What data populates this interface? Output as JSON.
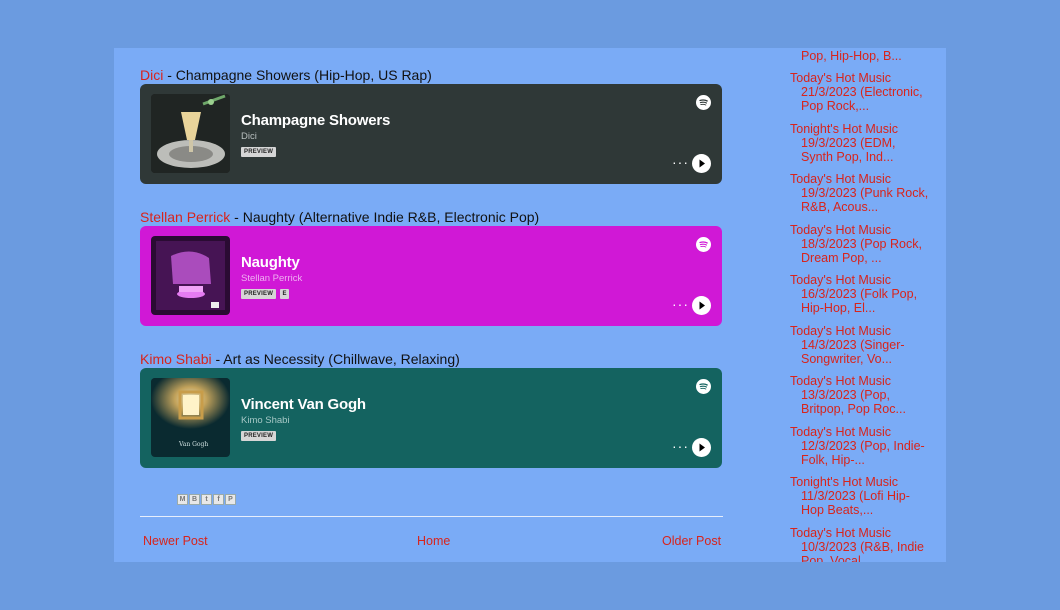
{
  "posts": [
    {
      "artist": "Dici",
      "title_rest": " - Champagne Showers (Hip-Hop, US Rap)",
      "card": {
        "track": "Champagne Showers",
        "artist": "Dici",
        "badges": [
          "PREVIEW"
        ],
        "bg_color": "#2f3837",
        "artist_color": "#b9c0bf"
      }
    },
    {
      "artist": "Stellan Perrick",
      "title_rest": " - Naughty (Alternative Indie R&B, Electronic Pop)",
      "card": {
        "track": "Naughty",
        "artist": "Stellan Perrick",
        "badges": [
          "PREVIEW",
          "E"
        ],
        "bg_color": "#d018d6",
        "artist_color": "#f0b0f2"
      }
    },
    {
      "artist": "Kimo Shabi",
      "title_rest": " - Art as Necessity (Chillwave, Relaxing)",
      "card": {
        "track": "Vincent Van Gogh",
        "artist": "Kimo Shabi",
        "badges": [
          "PREVIEW"
        ],
        "bg_color": "#146360",
        "artist_color": "#a6c8c6"
      }
    }
  ],
  "share_icons": [
    "email-icon",
    "blogger-icon",
    "twitter-icon",
    "facebook-icon",
    "pinterest-icon"
  ],
  "pager": {
    "newer": "Newer Post",
    "home": "Home",
    "older": "Older Post"
  },
  "sidebar": {
    "partial_top": "Pop, Hip-Hop, B...",
    "links": [
      {
        "line1": "Today's Hot Music",
        "rest": "21/3/2023 (Electronic, Pop Rock,..."
      },
      {
        "line1": "Tonight's Hot Music",
        "rest": "19/3/2023 (EDM, Synth Pop, Ind..."
      },
      {
        "line1": "Today's Hot Music",
        "rest": "19/3/2023 (Punk Rock, R&B, Acous..."
      },
      {
        "line1": "Today's Hot Music",
        "rest": "18/3/2023 (Pop Rock, Dream Pop, ..."
      },
      {
        "line1": "Today's Hot Music",
        "rest": "16/3/2023 (Folk Pop, Hip-Hop, El..."
      },
      {
        "line1": "Today's Hot Music",
        "rest": "14/3/2023 (Singer-Songwriter, Vo..."
      },
      {
        "line1": "Today's Hot Music",
        "rest": "13/3/2023 (Pop, Britpop, Pop Roc..."
      },
      {
        "line1": "Today's Hot Music",
        "rest": "12/3/2023 (Pop, Indie-Folk, Hip-..."
      },
      {
        "line1": "Tonight's Hot Music",
        "rest": "11/3/2023 (Lofi Hip-Hop Beats,..."
      },
      {
        "line1": "Today's Hot Music",
        "rest": "10/3/2023 (R&B, Indie Pop, Vocal..."
      }
    ]
  },
  "colors": {
    "outer_bg": "#6b9be0",
    "page_bg": "#7aabf6",
    "link_red": "#d8241c"
  }
}
